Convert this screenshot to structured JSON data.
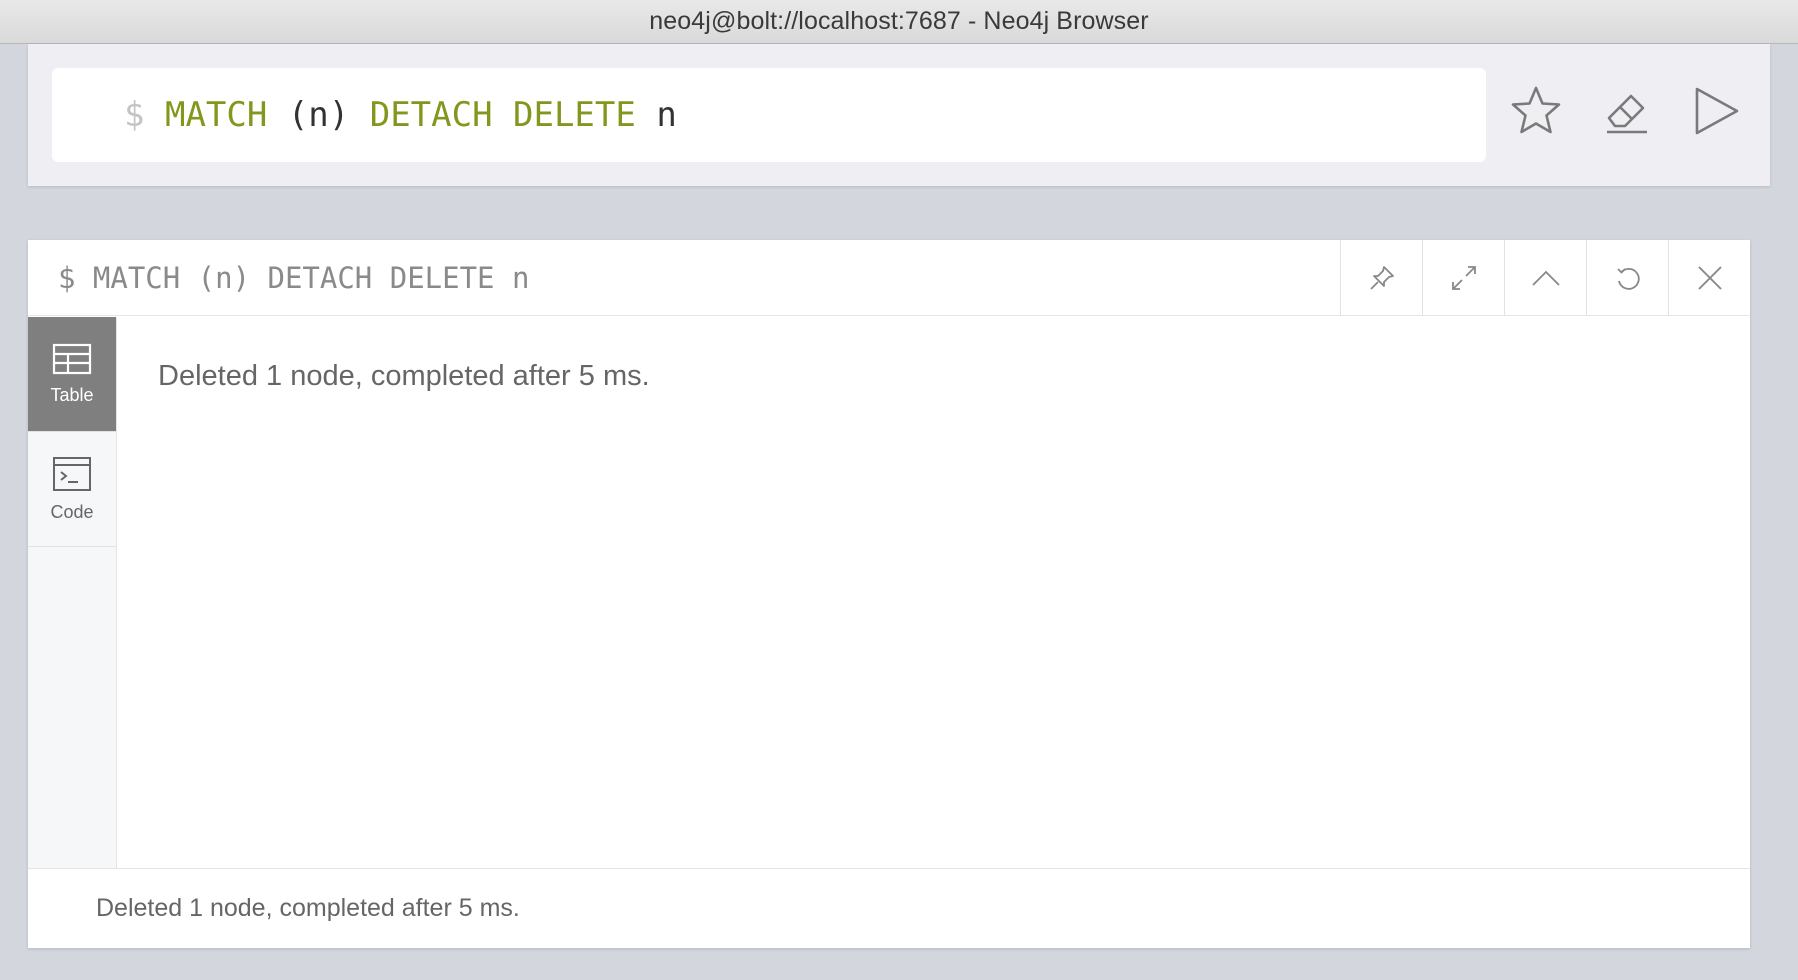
{
  "window": {
    "title": "neo4j@bolt://localhost:7687 - Neo4j Browser"
  },
  "editor": {
    "prompt": "$",
    "query_tokens": [
      {
        "text": "MATCH",
        "kind": "keyword"
      },
      {
        "text": "(n)",
        "kind": "plain"
      },
      {
        "text": "DETACH DELETE",
        "kind": "keyword"
      },
      {
        "text": "n",
        "kind": "plain"
      }
    ],
    "actions": [
      {
        "name": "favorite",
        "icon": "star-icon"
      },
      {
        "name": "clear",
        "icon": "eraser-icon"
      },
      {
        "name": "run",
        "icon": "play-icon"
      }
    ],
    "colors": {
      "keyword": "#83971e",
      "plain": "#333333",
      "prompt": "#c4c4c4"
    }
  },
  "frame": {
    "query": "$ MATCH (n) DETACH DELETE n",
    "buttons": [
      {
        "name": "pin",
        "icon": "pin-icon"
      },
      {
        "name": "fullscreen",
        "icon": "expand-icon"
      },
      {
        "name": "collapse",
        "icon": "chevron-up-icon"
      },
      {
        "name": "rerun",
        "icon": "rerun-icon"
      },
      {
        "name": "close",
        "icon": "close-icon"
      }
    ],
    "tabs": [
      {
        "label": "Table",
        "icon": "table-icon",
        "active": true
      },
      {
        "label": "Code",
        "icon": "code-icon",
        "active": false
      }
    ],
    "result_message": "Deleted 1 node, completed after 5 ms.",
    "status_message": "Deleted 1 node, completed after 5 ms."
  }
}
